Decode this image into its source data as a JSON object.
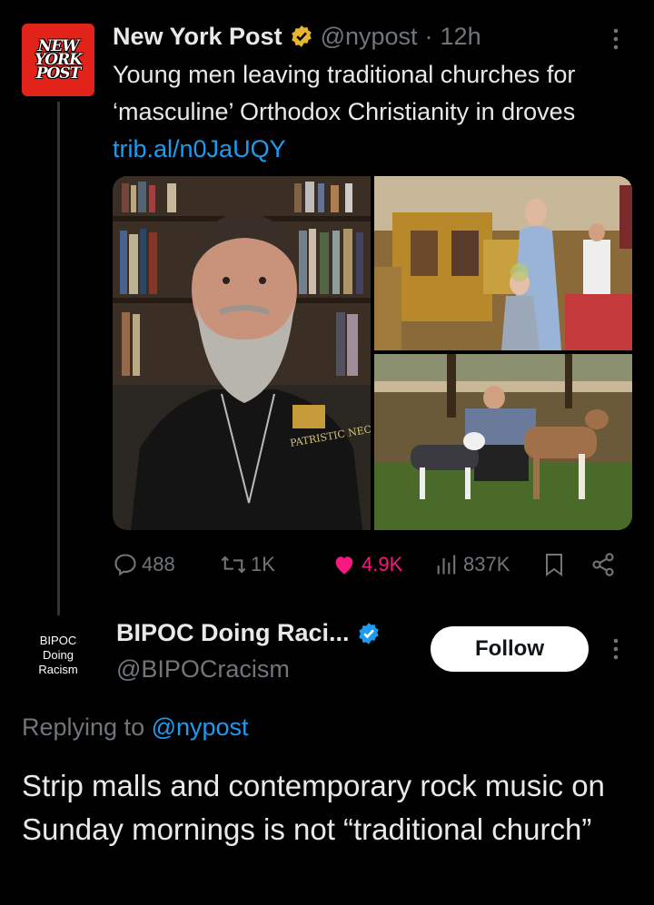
{
  "tweet": {
    "author_name": "New York Post",
    "author_handle": "@nypost",
    "separator": "·",
    "time": "12h",
    "avatar_text": [
      "NEW",
      "YORK",
      "POST"
    ],
    "text_main": "Young men leaving traditional churches for ‘masculine’ Orthodox Christianity in droves ",
    "link": "trib.al/n0JaUQY",
    "image_caption": "PATRISTIC NECTAR",
    "stats": {
      "replies": "488",
      "reposts": "1K",
      "likes": "4.9K",
      "views": "837K"
    },
    "colors": {
      "verified_badge": "#e8b62c",
      "like": "#f91880",
      "link": "#1d9bf0"
    }
  },
  "reply": {
    "author_name": "BIPOC Doing Raci...",
    "author_handle": "@BIPOCracism",
    "avatar_text": [
      "BIPOC",
      "Doing",
      "Racism"
    ],
    "follow_label": "Follow",
    "replying_prefix": "Replying to ",
    "replying_handle": "@nypost",
    "text": "Strip malls and contemporary rock music on Sunday mornings is not “traditional church”",
    "colors": {
      "verified_badge": "#1d9bf0"
    }
  }
}
